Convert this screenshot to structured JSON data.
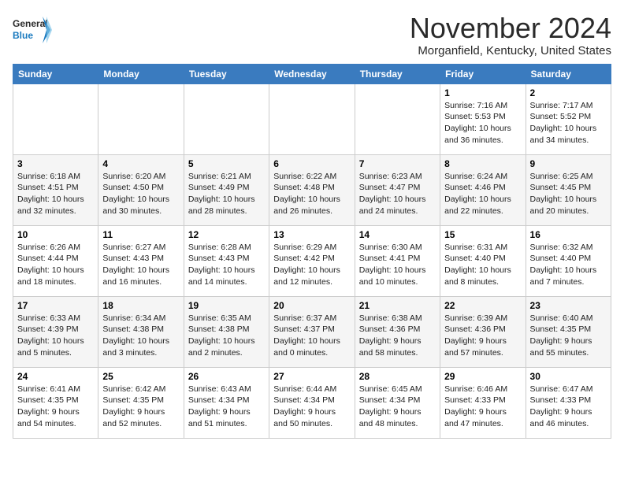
{
  "header": {
    "logo_line1": "General",
    "logo_line2": "Blue",
    "month_title": "November 2024",
    "location": "Morganfield, Kentucky, United States"
  },
  "weekdays": [
    "Sunday",
    "Monday",
    "Tuesday",
    "Wednesday",
    "Thursday",
    "Friday",
    "Saturday"
  ],
  "weeks": [
    [
      {
        "day": "",
        "info": ""
      },
      {
        "day": "",
        "info": ""
      },
      {
        "day": "",
        "info": ""
      },
      {
        "day": "",
        "info": ""
      },
      {
        "day": "",
        "info": ""
      },
      {
        "day": "1",
        "info": "Sunrise: 7:16 AM\nSunset: 5:53 PM\nDaylight: 10 hours\nand 36 minutes."
      },
      {
        "day": "2",
        "info": "Sunrise: 7:17 AM\nSunset: 5:52 PM\nDaylight: 10 hours\nand 34 minutes."
      }
    ],
    [
      {
        "day": "3",
        "info": "Sunrise: 6:18 AM\nSunset: 4:51 PM\nDaylight: 10 hours\nand 32 minutes."
      },
      {
        "day": "4",
        "info": "Sunrise: 6:20 AM\nSunset: 4:50 PM\nDaylight: 10 hours\nand 30 minutes."
      },
      {
        "day": "5",
        "info": "Sunrise: 6:21 AM\nSunset: 4:49 PM\nDaylight: 10 hours\nand 28 minutes."
      },
      {
        "day": "6",
        "info": "Sunrise: 6:22 AM\nSunset: 4:48 PM\nDaylight: 10 hours\nand 26 minutes."
      },
      {
        "day": "7",
        "info": "Sunrise: 6:23 AM\nSunset: 4:47 PM\nDaylight: 10 hours\nand 24 minutes."
      },
      {
        "day": "8",
        "info": "Sunrise: 6:24 AM\nSunset: 4:46 PM\nDaylight: 10 hours\nand 22 minutes."
      },
      {
        "day": "9",
        "info": "Sunrise: 6:25 AM\nSunset: 4:45 PM\nDaylight: 10 hours\nand 20 minutes."
      }
    ],
    [
      {
        "day": "10",
        "info": "Sunrise: 6:26 AM\nSunset: 4:44 PM\nDaylight: 10 hours\nand 18 minutes."
      },
      {
        "day": "11",
        "info": "Sunrise: 6:27 AM\nSunset: 4:43 PM\nDaylight: 10 hours\nand 16 minutes."
      },
      {
        "day": "12",
        "info": "Sunrise: 6:28 AM\nSunset: 4:43 PM\nDaylight: 10 hours\nand 14 minutes."
      },
      {
        "day": "13",
        "info": "Sunrise: 6:29 AM\nSunset: 4:42 PM\nDaylight: 10 hours\nand 12 minutes."
      },
      {
        "day": "14",
        "info": "Sunrise: 6:30 AM\nSunset: 4:41 PM\nDaylight: 10 hours\nand 10 minutes."
      },
      {
        "day": "15",
        "info": "Sunrise: 6:31 AM\nSunset: 4:40 PM\nDaylight: 10 hours\nand 8 minutes."
      },
      {
        "day": "16",
        "info": "Sunrise: 6:32 AM\nSunset: 4:40 PM\nDaylight: 10 hours\nand 7 minutes."
      }
    ],
    [
      {
        "day": "17",
        "info": "Sunrise: 6:33 AM\nSunset: 4:39 PM\nDaylight: 10 hours\nand 5 minutes."
      },
      {
        "day": "18",
        "info": "Sunrise: 6:34 AM\nSunset: 4:38 PM\nDaylight: 10 hours\nand 3 minutes."
      },
      {
        "day": "19",
        "info": "Sunrise: 6:35 AM\nSunset: 4:38 PM\nDaylight: 10 hours\nand 2 minutes."
      },
      {
        "day": "20",
        "info": "Sunrise: 6:37 AM\nSunset: 4:37 PM\nDaylight: 10 hours\nand 0 minutes."
      },
      {
        "day": "21",
        "info": "Sunrise: 6:38 AM\nSunset: 4:36 PM\nDaylight: 9 hours\nand 58 minutes."
      },
      {
        "day": "22",
        "info": "Sunrise: 6:39 AM\nSunset: 4:36 PM\nDaylight: 9 hours\nand 57 minutes."
      },
      {
        "day": "23",
        "info": "Sunrise: 6:40 AM\nSunset: 4:35 PM\nDaylight: 9 hours\nand 55 minutes."
      }
    ],
    [
      {
        "day": "24",
        "info": "Sunrise: 6:41 AM\nSunset: 4:35 PM\nDaylight: 9 hours\nand 54 minutes."
      },
      {
        "day": "25",
        "info": "Sunrise: 6:42 AM\nSunset: 4:35 PM\nDaylight: 9 hours\nand 52 minutes."
      },
      {
        "day": "26",
        "info": "Sunrise: 6:43 AM\nSunset: 4:34 PM\nDaylight: 9 hours\nand 51 minutes."
      },
      {
        "day": "27",
        "info": "Sunrise: 6:44 AM\nSunset: 4:34 PM\nDaylight: 9 hours\nand 50 minutes."
      },
      {
        "day": "28",
        "info": "Sunrise: 6:45 AM\nSunset: 4:34 PM\nDaylight: 9 hours\nand 48 minutes."
      },
      {
        "day": "29",
        "info": "Sunrise: 6:46 AM\nSunset: 4:33 PM\nDaylight: 9 hours\nand 47 minutes."
      },
      {
        "day": "30",
        "info": "Sunrise: 6:47 AM\nSunset: 4:33 PM\nDaylight: 9 hours\nand 46 minutes."
      }
    ]
  ]
}
